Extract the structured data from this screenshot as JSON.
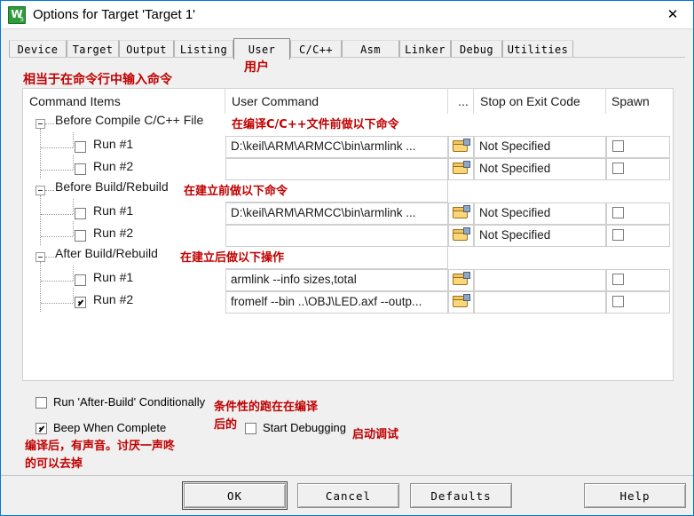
{
  "window": {
    "title": "Options for Target 'Target 1'",
    "app_icon": "keil-uvision-icon",
    "close_label": "✕"
  },
  "tabs": [
    {
      "label": "Device",
      "selected": false
    },
    {
      "label": "Target",
      "selected": false
    },
    {
      "label": "Output",
      "selected": false
    },
    {
      "label": "Listing",
      "selected": false
    },
    {
      "label": "User",
      "selected": true
    },
    {
      "label": "C/C++",
      "selected": false
    },
    {
      "label": "Asm",
      "selected": false
    },
    {
      "label": "Linker",
      "selected": false
    },
    {
      "label": "Debug",
      "selected": false
    },
    {
      "label": "Utilities",
      "selected": false
    }
  ],
  "annotations": {
    "user_tab_zh": "用户",
    "command_line_zh": "相当于在命令行中输入命令",
    "before_compile_zh": "在编译C/C++文件前做以下命令",
    "before_build_zh": "在建立前做以下命令",
    "after_build_zh": "在建立后做以下操作",
    "conditional_zh_line1": "条件性的跑在在编译",
    "conditional_zh_line2": "后的",
    "beep_zh_line1": "编译后，有声音。讨厌一声咚",
    "beep_zh_line2": "的可以去掉",
    "start_debug_zh": "启动调试"
  },
  "grid": {
    "headers": {
      "command_items": "Command Items",
      "user_command": "User Command",
      "ellipsis": "...",
      "stop_on_exit": "Stop on Exit Code",
      "spawn": "Spawn"
    },
    "groups": [
      {
        "label": "Before Compile C/C++ File",
        "expanded": true,
        "rows": [
          {
            "label": "Run #1",
            "checked": false,
            "command": "D:\\keil\\ARM\\ARMCC\\bin\\armlink ...",
            "browse_icon": "folder-open-icon",
            "stop_on_exit": "Not Specified",
            "spawn": false
          },
          {
            "label": "Run #2",
            "checked": false,
            "command": "",
            "browse_icon": "folder-open-icon",
            "stop_on_exit": "Not Specified",
            "spawn": false
          }
        ]
      },
      {
        "label": "Before Build/Rebuild",
        "expanded": true,
        "rows": [
          {
            "label": "Run #1",
            "checked": false,
            "command": "D:\\keil\\ARM\\ARMCC\\bin\\armlink ...",
            "browse_icon": "folder-open-icon",
            "stop_on_exit": "Not Specified",
            "spawn": false
          },
          {
            "label": "Run #2",
            "checked": false,
            "command": "",
            "browse_icon": "folder-open-icon",
            "stop_on_exit": "Not Specified",
            "spawn": false
          }
        ]
      },
      {
        "label": "After Build/Rebuild",
        "expanded": true,
        "rows": [
          {
            "label": "Run #1",
            "checked": false,
            "command": "armlink --info sizes,total",
            "browse_icon": "folder-open-icon",
            "stop_on_exit": "",
            "spawn": false
          },
          {
            "label": "Run #2",
            "checked": true,
            "command": "fromelf --bin ..\\OBJ\\LED.axf --outp...",
            "browse_icon": "folder-open-icon",
            "stop_on_exit": "",
            "spawn": false
          }
        ]
      }
    ]
  },
  "options": {
    "run_after_build": {
      "label": "Run 'After-Build' Conditionally",
      "checked": false
    },
    "beep_when_complete": {
      "label": "Beep When Complete",
      "checked": true
    },
    "start_debugging": {
      "label": "Start Debugging",
      "checked": false
    }
  },
  "footer": {
    "ok": "OK",
    "cancel": "Cancel",
    "defaults": "Defaults",
    "help": "Help"
  }
}
